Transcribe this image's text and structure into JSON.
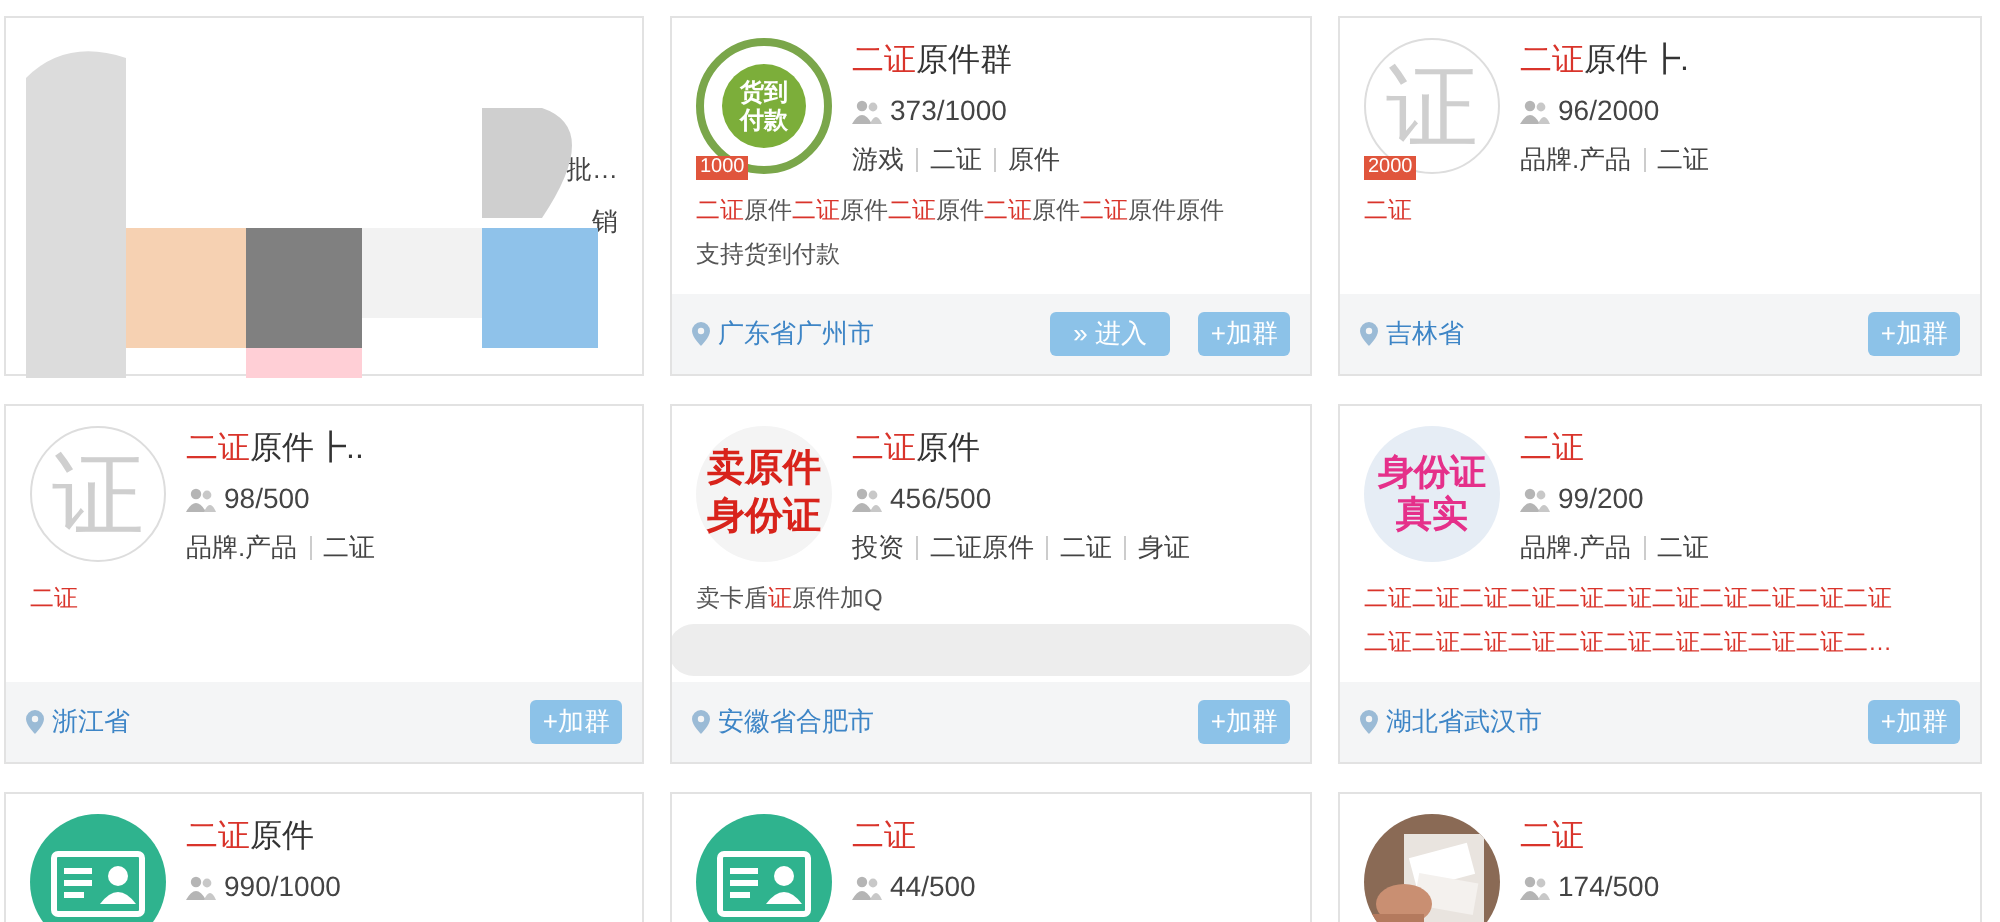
{
  "cards": [
    {
      "kind": "redacted",
      "fragments": [
        "批…",
        "销"
      ]
    },
    {
      "kind": "group",
      "avatar": {
        "kind": "stamp",
        "text": "货到付款",
        "badge": "1000"
      },
      "title": [
        {
          "text": "二证",
          "highlight": true
        },
        {
          "text": "原件群",
          "highlight": false
        }
      ],
      "members": "373/1000",
      "tags": [
        "游戏",
        "二证",
        "原件"
      ],
      "description": [
        [
          {
            "text": "二证",
            "highlight": true
          },
          {
            "text": "原件",
            "highlight": false
          },
          {
            "text": "二证",
            "highlight": true
          },
          {
            "text": "原件",
            "highlight": false
          },
          {
            "text": "二证",
            "highlight": true
          },
          {
            "text": "原件",
            "highlight": false
          },
          {
            "text": "二证",
            "highlight": true
          },
          {
            "text": "原件",
            "highlight": false
          },
          {
            "text": "二证",
            "highlight": true
          },
          {
            "text": "原件原件",
            "highlight": false
          }
        ],
        [
          {
            "text": "支持货到付款",
            "highlight": false
          }
        ]
      ],
      "location": "广东省广州市",
      "buttons": [
        {
          "kind": "enter",
          "label": "» 进入"
        },
        {
          "kind": "join",
          "label": "+加群"
        }
      ]
    },
    {
      "kind": "group",
      "avatar": {
        "kind": "letter",
        "text": "证",
        "badge": "2000"
      },
      "title": [
        {
          "text": "二证",
          "highlight": true
        },
        {
          "text": "原件┣.",
          "highlight": false
        }
      ],
      "members": "96/2000",
      "tags": [
        "品牌.产品",
        "二证"
      ],
      "description": [
        [
          {
            "text": "二证",
            "highlight": true
          }
        ]
      ],
      "location": "吉林省",
      "buttons": [
        {
          "kind": "join",
          "label": "+加群"
        }
      ]
    },
    {
      "kind": "group",
      "avatar": {
        "kind": "letter",
        "text": "证"
      },
      "title": [
        {
          "text": "二证",
          "highlight": true
        },
        {
          "text": "原件┣..",
          "highlight": false
        }
      ],
      "members": "98/500",
      "tags": [
        "品牌.产品",
        "二证"
      ],
      "description": [
        [
          {
            "text": "二证",
            "highlight": true
          }
        ]
      ],
      "location": "浙江省",
      "buttons": [
        {
          "kind": "join",
          "label": "+加群"
        }
      ]
    },
    {
      "kind": "group",
      "avatar": {
        "kind": "seal",
        "text": "卖原件身份证"
      },
      "title": [
        {
          "text": "二证",
          "highlight": true
        },
        {
          "text": "原件",
          "highlight": false
        }
      ],
      "members": "456/500",
      "tags": [
        "投资",
        "二证原件",
        "二证",
        "身证"
      ],
      "description": [
        [
          {
            "text": "卖卡盾",
            "highlight": false
          },
          {
            "text": "证",
            "highlight": true
          },
          {
            "text": "原件加Q",
            "highlight": false
          }
        ]
      ],
      "blurred": true,
      "location": "安徽省合肥市",
      "buttons": [
        {
          "kind": "join",
          "label": "+加群"
        }
      ]
    },
    {
      "kind": "group",
      "avatar": {
        "kind": "pink",
        "text": "身份证真实"
      },
      "title": [
        {
          "text": "二证",
          "highlight": true
        }
      ],
      "members": "99/200",
      "tags": [
        "品牌.产品",
        "二证"
      ],
      "description": [
        [
          {
            "text": "二证二证二证二证二证二证二证二证二证二证二证",
            "highlight": true
          }
        ],
        [
          {
            "text": "二证二证二证二证二证二证二证二证二证二证二…",
            "highlight": true
          }
        ]
      ],
      "location": "湖北省武汉市",
      "buttons": [
        {
          "kind": "join",
          "label": "+加群"
        }
      ]
    },
    {
      "kind": "group",
      "avatar": {
        "kind": "id-card"
      },
      "title": [
        {
          "text": "二证",
          "highlight": true
        },
        {
          "text": "原件",
          "highlight": false
        }
      ],
      "members": "990/1000"
    },
    {
      "kind": "group",
      "avatar": {
        "kind": "id-card"
      },
      "title": [
        {
          "text": "二证",
          "highlight": true
        }
      ],
      "members": "44/500"
    },
    {
      "kind": "group",
      "avatar": {
        "kind": "picture"
      },
      "title": [
        {
          "text": "二证",
          "highlight": true
        }
      ],
      "members": "174/500"
    }
  ]
}
